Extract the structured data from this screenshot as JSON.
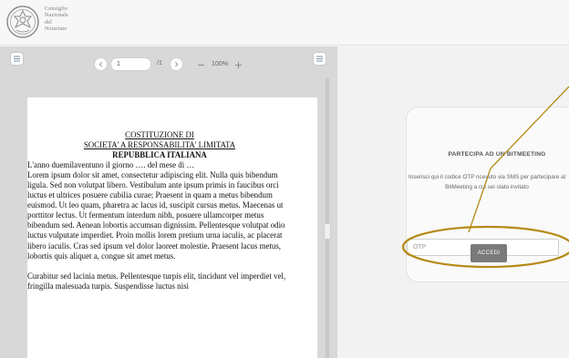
{
  "header": {
    "logo_lines": [
      "Consiglio",
      "Nazionale",
      "del",
      "Notariato"
    ]
  },
  "viewer": {
    "page_input_value": "1",
    "page_total": "/1",
    "zoom_level": "100%",
    "zoom_out_glyph": "−",
    "zoom_in_glyph": "+",
    "prev_glyph": "‹",
    "next_glyph": "›"
  },
  "document": {
    "title_line1": "COSTITUZIONE DI",
    "title_line2": "SOCIETA' A RESPONSABILITA' LIMITATA",
    "title_line3": "REPUBBLICA ITALIANA",
    "paragraph1": "L'anno duemilaventuno il giorno …. del mese di …",
    "paragraph2": "Lorem ipsum dolor sit amet, consectetur adipiscing elit. Nulla quis bibendum ligula. Sed non volutpat libero. Vestibulum ante ipsum primis in faucibus orci luctus et ultrices posuere cubilia curae; Praesent in quam a metus bibendum euismod. Ut leo quam, pharetra ac lacus id, suscipit cursus metus. Maecenas ut porttitor lectus. Ut fermentum interdum nibh, posuere ullamcorper metus bibendum sed. Aenean lobortis accumsan dignissim. Pellentesque volutpat odio luctus vulputate imperdiet. Proin mollis lorem pretium urna iaculis, ac placerat libero iaculis. Cras sed ipsum vel dolor laoreet molestie. Praesent lacus metus, lobortis quis aliquet a, congue sit amet metus.",
    "paragraph3": "Curabitur sed lacinia metus. Pellentesque turpis elit, tincidunt vel imperdiet vel, fringilla malesuada turpis. Suspendisse luctus nisi"
  },
  "meeting": {
    "title": "PARTECIPA AD UN BITMEETING",
    "description": "Inserisci qui il codice OTP ricevuto via SMS per partecipare al BitMeeting a cui sei stato invitato",
    "otp_placeholder": "OTP",
    "submit_label": "ACCEDI"
  },
  "annotation_color": "#b58a16",
  "icons": [
    "logo-seal-icon",
    "sidebar-toggle-icon",
    "chevron-left-icon",
    "chevron-right-icon",
    "minus-icon",
    "plus-icon",
    "panel-toggle-icon"
  ]
}
